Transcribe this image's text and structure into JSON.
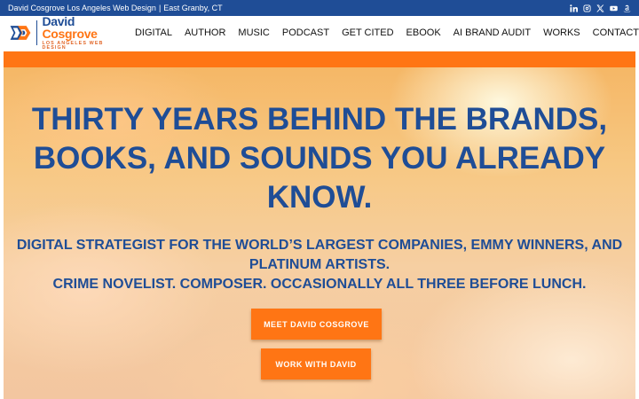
{
  "topbar": {
    "site_line": "David Cosgrove Los Angeles Web Design",
    "separator": "|",
    "location": "East Granby, CT",
    "social_icons": [
      "linkedin-icon",
      "instagram-icon",
      "x-icon",
      "youtube-icon",
      "amazon-icon"
    ]
  },
  "logo": {
    "first_name": "David",
    "last_name": "Cosgrove",
    "tagline": "LOS ANGELES WEB DESIGN"
  },
  "nav": {
    "items": [
      "DIGITAL",
      "AUTHOR",
      "MUSIC",
      "PODCAST",
      "GET CITED",
      "EBOOK",
      "AI BRAND AUDIT",
      "WORKS",
      "CONTACT"
    ]
  },
  "hero": {
    "title": "THIRTY YEARS BEHIND THE BRANDS, BOOKS, AND SOUNDS YOU ALREADY KNOW.",
    "subtitle_line1": "DIGITAL STRATEGIST FOR THE WORLD’S LARGEST COMPANIES, EMMY WINNERS, AND PLATINUM ARTISTS.",
    "subtitle_line2": "CRIME NOVELIST. COMPOSER. OCCASIONALLY ALL THREE BEFORE LUNCH.",
    "primary_cta": "MEET DAVID COSGROVE",
    "secondary_cta": "WORK WITH DAVID"
  },
  "colors": {
    "brand_blue": "#1f4d96",
    "brand_orange": "#ff7514"
  }
}
